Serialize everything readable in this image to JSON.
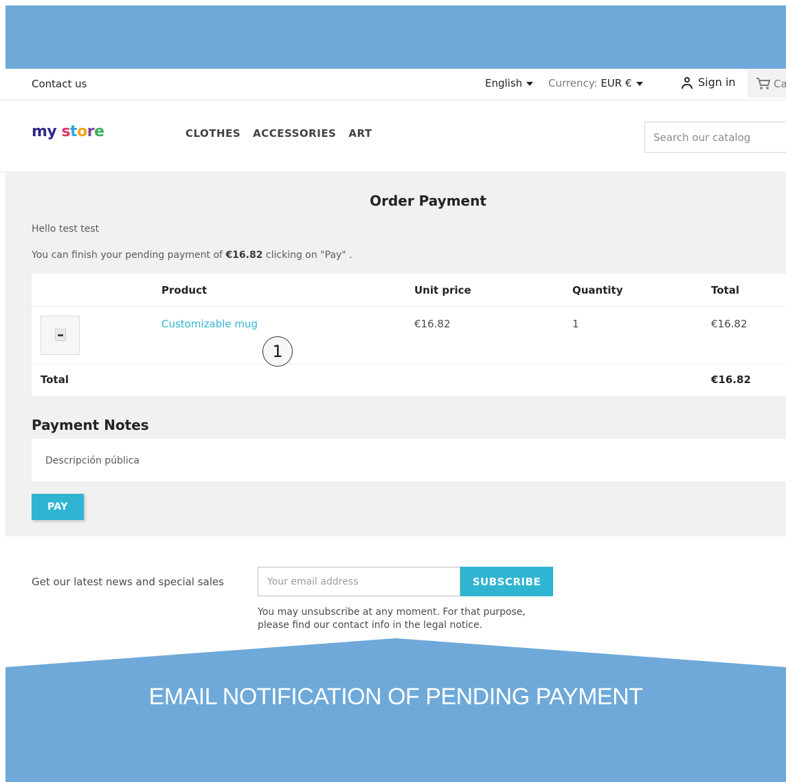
{
  "topbar": {
    "contact": "Contact us",
    "language": "English",
    "currency_label": "Currency:",
    "currency_value": "EUR €",
    "sign_in": "Sign in",
    "cart": "Ca"
  },
  "header": {
    "logo": {
      "my": "my",
      "store": [
        "s",
        "t",
        "o",
        "r",
        "e"
      ]
    },
    "nav": [
      "CLOTHES",
      "ACCESSORIES",
      "ART"
    ],
    "search_placeholder": "Search our catalog"
  },
  "order": {
    "title": "Order Payment",
    "hello": "Hello test test",
    "pending_prefix": "You can finish your pending payment of ",
    "pending_amount": "€16.82",
    "pending_suffix": " clicking on \"Pay\" .",
    "columns": [
      "Product",
      "Unit price",
      "Quantity",
      "Total"
    ],
    "rows": [
      {
        "product": "Customizable mug",
        "unit_price": "€16.82",
        "quantity": "1",
        "total": "€16.82"
      }
    ],
    "total_label": "Total",
    "total_value": "€16.82",
    "annotation_badge": "1"
  },
  "payment_notes": {
    "title": "Payment Notes",
    "text": "Descripción pública",
    "pay_button": "PAY"
  },
  "newsletter": {
    "text": "Get our latest news and special sales",
    "email_placeholder": "Your email address",
    "subscribe_button": "SUBSCRIBE",
    "unsubscribe_note": "You may unsubscribe at any moment. For that purpose, please find our contact info in the legal notice."
  },
  "banner": {
    "caption": "EMAIL NOTIFICATION OF PENDING PAYMENT"
  },
  "colors": {
    "banner_blue": "#6ea9d9",
    "accent": "#2fb5d2"
  }
}
